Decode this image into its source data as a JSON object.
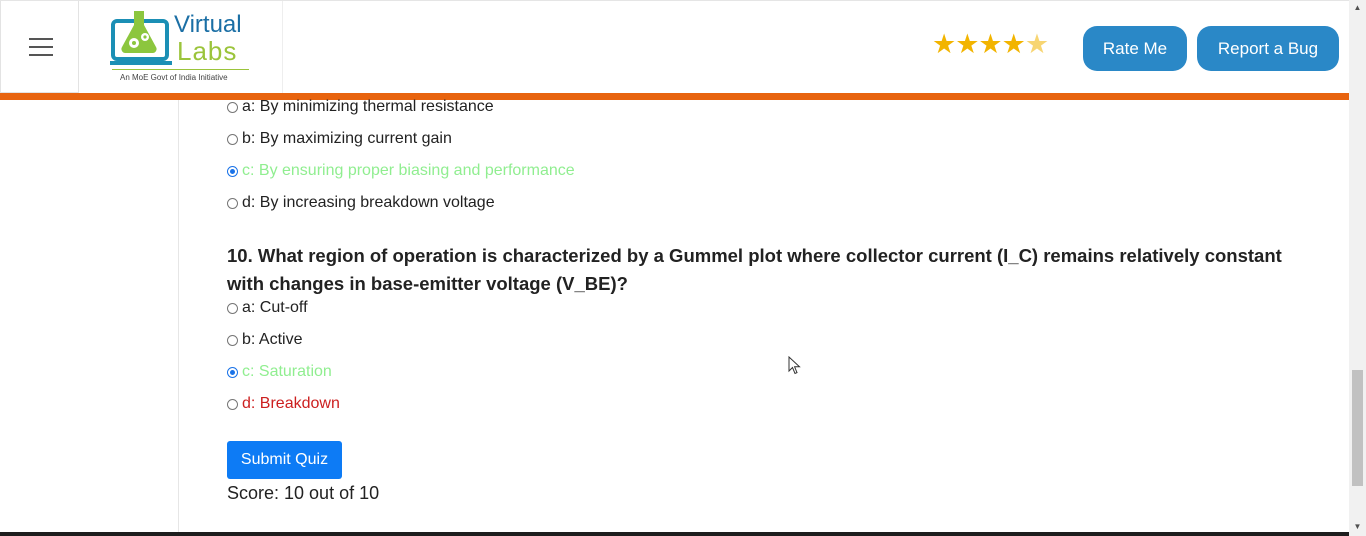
{
  "header": {
    "logo_title_1": "Virtual",
    "logo_title_2": "Labs",
    "logo_tagline": "An MoE Govt of India Initiative",
    "rating_stars": "★★★★",
    "rating_half_star": "★",
    "rate_button": "Rate Me",
    "bug_button": "Report a Bug"
  },
  "previous_question_options": [
    {
      "label": "a: By minimizing thermal resistance",
      "checked": false,
      "state": "normal"
    },
    {
      "label": "b: By maximizing current gain",
      "checked": false,
      "state": "normal"
    },
    {
      "label": "c: By ensuring proper biasing and performance",
      "checked": true,
      "state": "correct"
    },
    {
      "label": "d: By increasing breakdown voltage",
      "checked": false,
      "state": "normal"
    }
  ],
  "question_10": {
    "text": "10. What region of operation is characterized by a Gummel plot where collector current (I_C) remains relatively constant with changes in base-emitter voltage (V_BE)?",
    "options": [
      {
        "label": "a: Cut-off",
        "checked": false,
        "state": "normal"
      },
      {
        "label": "b: Active",
        "checked": false,
        "state": "normal"
      },
      {
        "label": "c: Saturation",
        "checked": true,
        "state": "correct"
      },
      {
        "label": "d: Breakdown",
        "checked": false,
        "state": "wrong"
      }
    ]
  },
  "submit_label": "Submit Quiz",
  "score_text": "Score: 10 out of 10",
  "colors": {
    "accent_orange": "#e8640f",
    "button_blue": "#2a88c7",
    "submit_blue": "#0d7bf5",
    "correct_green": "#90ee90",
    "wrong_red": "#cc1f1f"
  }
}
